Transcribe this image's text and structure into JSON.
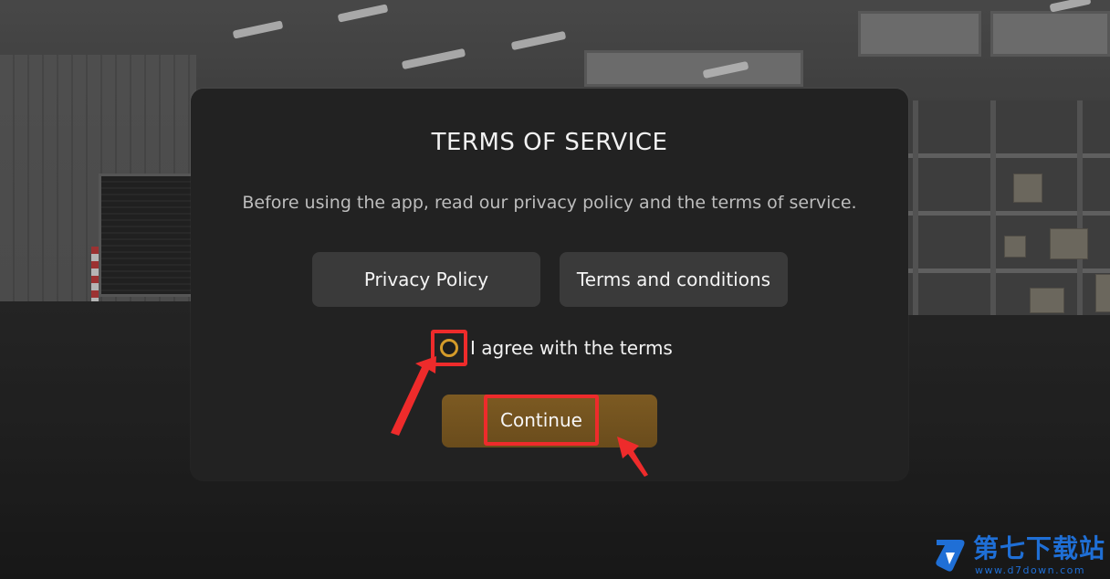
{
  "dialog": {
    "title": "TERMS OF SERVICE",
    "description": "Before using the app, read our privacy policy and the terms of service.",
    "privacy_button": "Privacy Policy",
    "terms_button": "Terms and conditions",
    "agree_label": "I agree with the terms",
    "agree_checked": false,
    "continue_button": "Continue"
  },
  "colors": {
    "accent": "#d49b2a",
    "continue_bg": "#6a4c1c",
    "annotation": "#ee2b2b",
    "watermark": "#1f6fd6"
  },
  "watermark": {
    "site_name": "第七下载站",
    "url": "www.d7down.com"
  }
}
